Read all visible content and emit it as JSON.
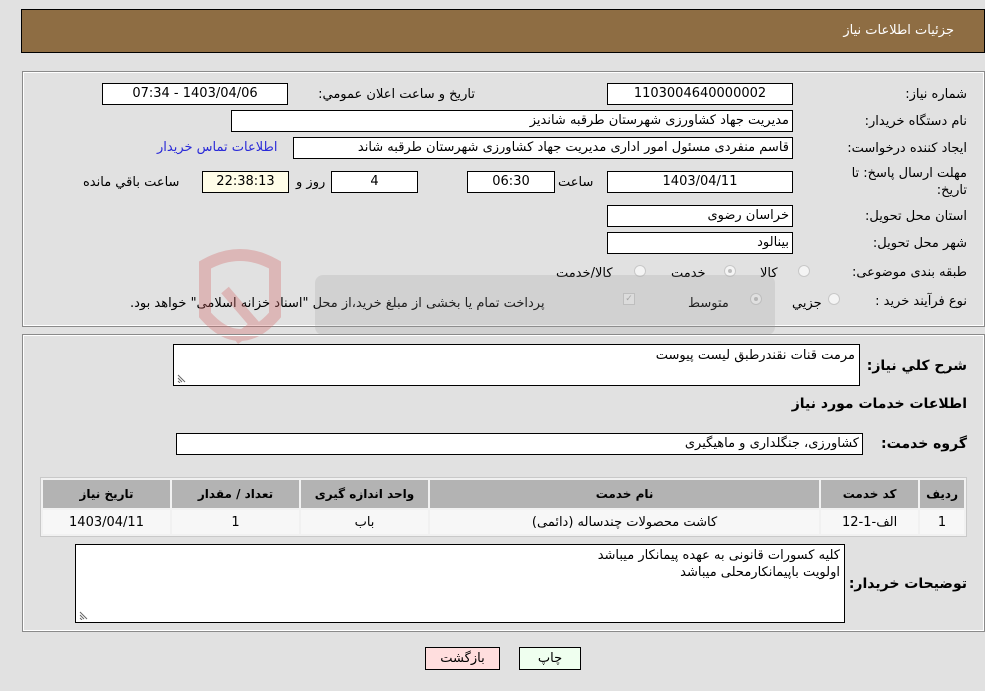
{
  "header": {
    "title": "جزئیات اطلاعات نیاز"
  },
  "form": {
    "need_number": {
      "label": "شماره نیاز:",
      "value": "1103004640000002"
    },
    "announce_datetime": {
      "label": "تاریخ و ساعت اعلان عمومي:",
      "value": "1403/04/06 - 07:34"
    },
    "buyer_org": {
      "label": "نام دستگاه خریدار:",
      "value": "مدیریت جهاد کشاورزی شهرستان طرقبه شاندیز"
    },
    "requester": {
      "label": "ایجاد کننده درخواست:",
      "value": "قاسم منفردی مسئول امور اداری مدیریت جهاد کشاورزی شهرستان طرقبه شاند"
    },
    "buyer_contact_link": "اطلاعات تماس خریدار",
    "deadline": {
      "label": "مهلت ارسال پاسخ: تا تاریخ:",
      "date": "1403/04/11",
      "time_label": "ساعت",
      "time": "06:30",
      "days": "4",
      "days_label": "روز و",
      "remaining": "22:38:13",
      "remaining_label": "ساعت باقي مانده"
    },
    "province": {
      "label": "استان محل تحویل:",
      "value": "خراسان رضوی"
    },
    "city": {
      "label": "شهر محل تحویل:",
      "value": "بینالود"
    },
    "category": {
      "label": "طبقه بندی موضوعی:",
      "options": [
        "کالا",
        "خدمت",
        "کالا/خدمت"
      ],
      "selected": "خدمت"
    },
    "purchase_type": {
      "label": "نوع فرآیند خرید :",
      "options": [
        "جزيي",
        "متوسط"
      ],
      "selected": "متوسط",
      "treasury_note": "پرداخت تمام یا بخشی از مبلغ خرید،از محل \"اسناد خزانه اسلامی\" خواهد بود."
    }
  },
  "details": {
    "description_label": "شرح كلي نیاز:",
    "description": "مرمت قنات نقندرطبق لیست پیوست",
    "services_title": "اطلاعات خدمات مورد نیاز",
    "service_group_label": "گروه خدمت:",
    "service_group": "کشاورزی، جنگلداری و ماهیگیری",
    "table": {
      "headers": [
        "ردیف",
        "کد خدمت",
        "نام خدمت",
        "واحد اندازه گیری",
        "تعداد / مقدار",
        "تاریخ نیاز"
      ],
      "rows": [
        [
          "1",
          "الف-1-12",
          "کاشت محصولات چندساله (دائمی)",
          "باب",
          "1",
          "1403/04/11"
        ]
      ]
    },
    "buyer_notes_label": "توضیحات خریدار:",
    "buyer_notes_lines": [
      "کلیه کسورات قانونی به عهده پیمانکار میباشد",
      "اولویت باپیمانکارمحلی میباشد"
    ]
  },
  "buttons": {
    "print": "چاپ",
    "back": "بازگشت"
  },
  "colors": {
    "header_bg": "#8e6d43",
    "print_bg": "#efffef",
    "back_bg": "#ffdede",
    "link": "#2a2ad8"
  }
}
